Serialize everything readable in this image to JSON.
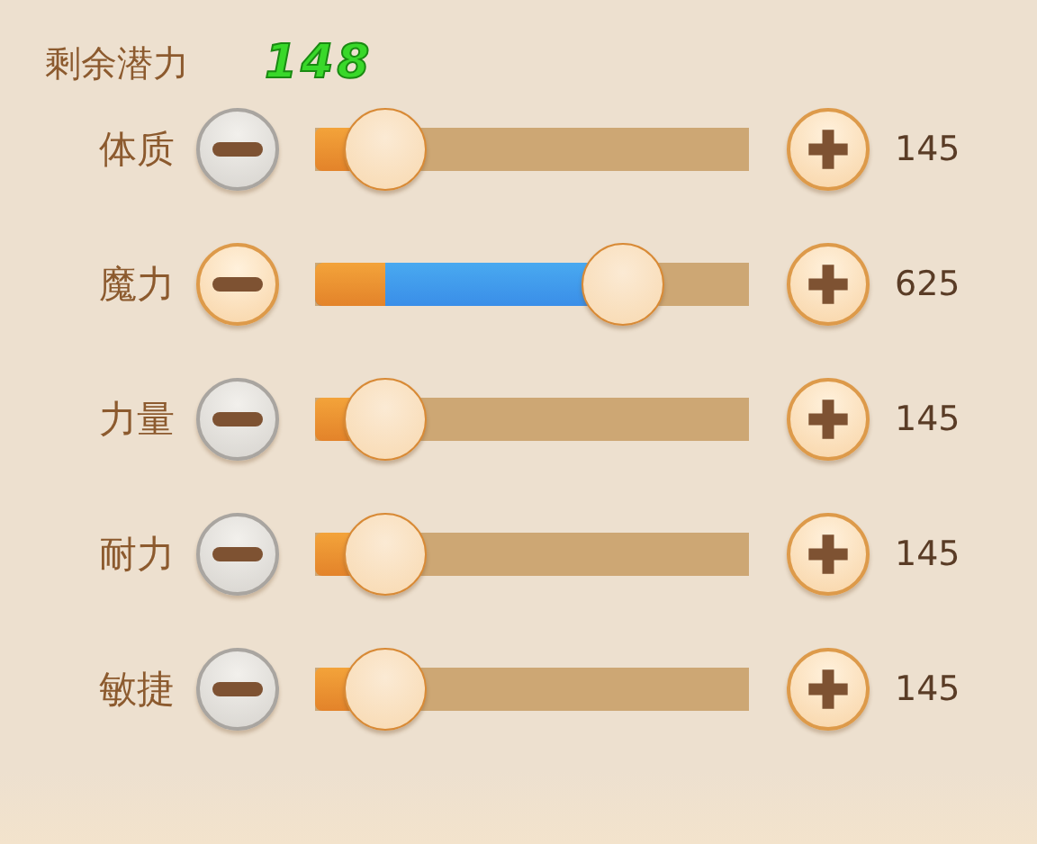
{
  "potential": {
    "label": "剩余潜力",
    "value": "148"
  },
  "stats": [
    {
      "name": "体质",
      "minus_disabled": true,
      "base": {
        "level": 0.16
      },
      "level": 0.16,
      "value": "145"
    },
    {
      "name": "魔力",
      "minus_disabled": false,
      "base": {
        "level": 0.16
      },
      "level": 0.71,
      "value": "625"
    },
    {
      "name": "力量",
      "minus_disabled": true,
      "base": {
        "level": 0.16
      },
      "level": 0.16,
      "value": "145"
    },
    {
      "name": "耐力",
      "minus_disabled": true,
      "base": {
        "level": 0.16
      },
      "level": 0.16,
      "value": "145"
    },
    {
      "name": "敏捷",
      "minus_disabled": true,
      "base": {
        "level": 0.16
      },
      "level": 0.16,
      "value": "145"
    }
  ]
}
